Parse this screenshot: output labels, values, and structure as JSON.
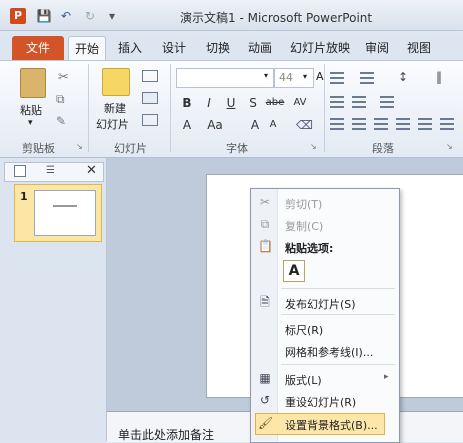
{
  "window": {
    "title": "演示文稿1 - Microsoft PowerPoint",
    "app_icon_letter": "P"
  },
  "tabs": [
    "文件",
    "开始",
    "插入",
    "设计",
    "切换",
    "动画",
    "幻灯片放映",
    "审阅",
    "视图"
  ],
  "ribbon": {
    "paste_label": "粘贴",
    "new_slide_label_1": "新建",
    "new_slide_label_2": "幻灯片",
    "font_size": "44",
    "groups": {
      "clipboard": "剪贴板",
      "slides": "幻灯片",
      "font": "字体",
      "paragraph": "段落"
    },
    "font_buttons": [
      "B",
      "I",
      "U",
      "S",
      "abe",
      "AV"
    ],
    "font_buttons_row2": [
      "A",
      "Aa",
      "A",
      "A"
    ]
  },
  "slide_panel": {
    "slide_number": "1"
  },
  "notes": {
    "placeholder": "单击此处添加备注"
  },
  "context_menu": {
    "items": [
      {
        "label": "剪切(T)",
        "icon": "scissors-icon",
        "enabled": false
      },
      {
        "label": "复制(C)",
        "icon": "copy-icon",
        "enabled": false
      },
      {
        "label": "粘贴选项:",
        "icon": "clipboard-icon",
        "enabled": true,
        "bold": true
      },
      {
        "label": "A",
        "icon": "",
        "enabled": true
      },
      {
        "label": "发布幻灯片(S)",
        "icon": "publish-icon",
        "enabled": true
      },
      {
        "label": "标尺(R)",
        "icon": "",
        "enabled": true
      },
      {
        "label": "网格和参考线(I)...",
        "icon": "",
        "enabled": true
      },
      {
        "label": "版式(L)",
        "icon": "layout-icon",
        "enabled": true
      },
      {
        "label": "重设幻灯片(R)",
        "icon": "reset-icon",
        "enabled": true
      },
      {
        "label": "设置背景格式(B)...",
        "icon": "background-icon",
        "enabled": true,
        "highlighted": true
      }
    ]
  },
  "colors": {
    "file_tab": "#d4542a",
    "highlight": "#fde7a8"
  }
}
